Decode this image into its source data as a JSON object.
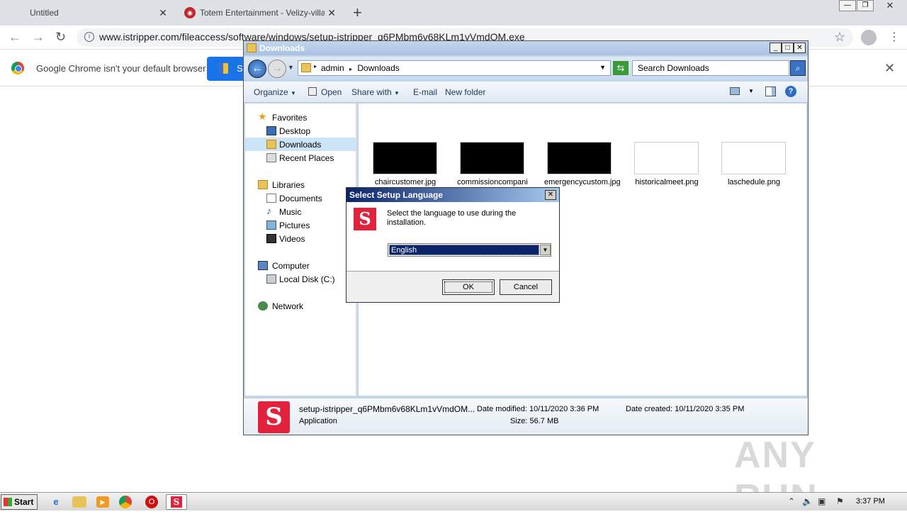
{
  "browser": {
    "tabs": [
      {
        "label": "Untitled"
      },
      {
        "label": "Totem Entertainment - Velizy-villacou"
      }
    ],
    "url": "www.istripper.com/fileaccess/software/windows/setup-istripper_q6PMbm6v68KLm1vVmdOM.exe",
    "infobar_text": "Google Chrome isn't your default browser",
    "infobar_button_text": "S"
  },
  "explorer": {
    "title": "Downloads",
    "breadcrumb": [
      "admin",
      "Downloads"
    ],
    "search_placeholder": "Search Downloads",
    "commands": [
      "Organize",
      "Open",
      "Share with",
      "E-mail",
      "New folder"
    ],
    "nav": {
      "favorites_header": "Favorites",
      "favorites": [
        "Desktop",
        "Downloads",
        "Recent Places"
      ],
      "libraries_header": "Libraries",
      "libraries": [
        "Documents",
        "Music",
        "Pictures",
        "Videos"
      ],
      "computer_header": "Computer",
      "computer": [
        "Local Disk (C:)"
      ],
      "network_header": "Network"
    },
    "files": [
      {
        "name": "chaircustomer.jpg",
        "dark": true
      },
      {
        "name": "commissioncompani",
        "dark": true
      },
      {
        "name": "emergencycustom.jpg",
        "dark": true
      },
      {
        "name": "historicalmeet.png",
        "dark": false
      },
      {
        "name": "laschedule.png",
        "dark": false
      }
    ],
    "details": {
      "filename": "setup-istripper_q6PMbm6v68KLm1vVmdOM...",
      "type": "Application",
      "modified": "Date modified: 10/11/2020 3:36 PM",
      "created": "Date created: 10/11/2020 3:35 PM",
      "size": "Size: 56.7 MB"
    }
  },
  "dialog": {
    "title": "Select Setup Language",
    "message": "Select the language to use during the installation.",
    "language": "English",
    "ok": "OK",
    "cancel": "Cancel"
  },
  "watermark": "ANY RUN",
  "taskbar": {
    "start": "Start",
    "clock": "3:37 PM"
  }
}
